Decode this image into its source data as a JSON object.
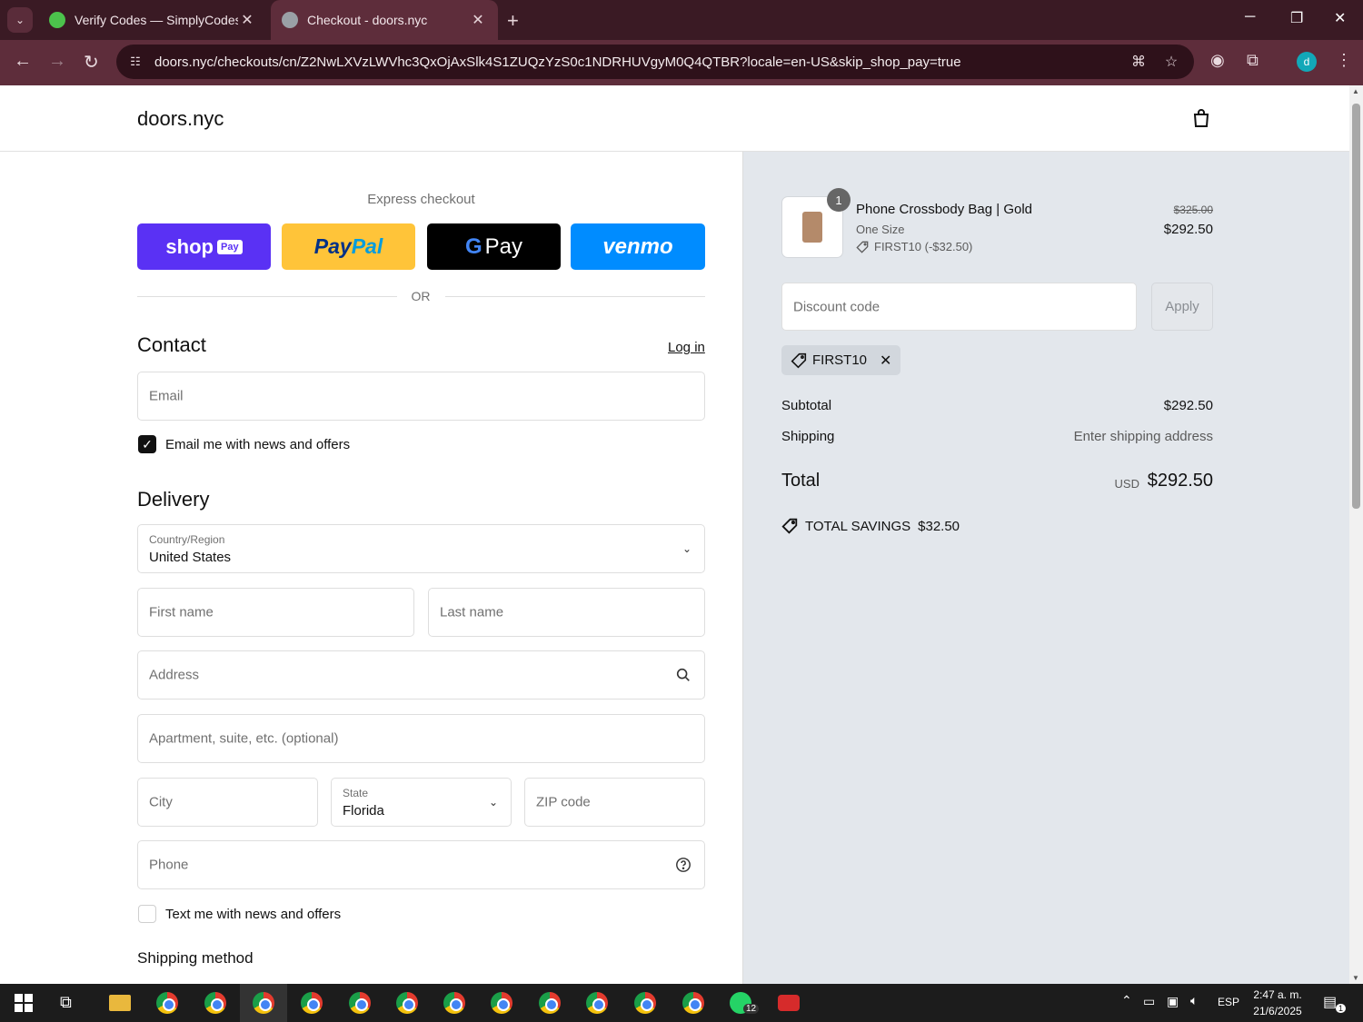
{
  "browser": {
    "tabs": [
      {
        "title": "Verify Codes — SimplyCodes",
        "favicon": "simplycodes-icon",
        "color": "#4cc24c"
      },
      {
        "title": "Checkout - doors.nyc",
        "favicon": "globe-icon",
        "color": "#9aa0a6",
        "active": true
      }
    ],
    "url": "doors.nyc/checkouts/cn/Z2NwLXVzLWVhc3QxOjAxSlk4S1ZUQzYzS0c1NDRHUVgyM0Q4QTBR?locale=en-US&skip_shop_pay=true",
    "profile_initial": "d"
  },
  "page": {
    "brand": "doors.nyc",
    "express_checkout": "Express checkout",
    "pay_buttons": {
      "shop": "shop",
      "shop_pay": "Pay",
      "paypal_1": "Pay",
      "paypal_2": "Pal",
      "gpay": "Pay",
      "gpay_g": "G",
      "venmo": "venmo"
    },
    "or": "OR",
    "contact": {
      "heading": "Contact",
      "login": "Log in",
      "email_placeholder": "Email",
      "news_label": "Email me with news and offers",
      "news_checked": true
    },
    "delivery": {
      "heading": "Delivery",
      "country_label": "Country/Region",
      "country_value": "United States",
      "first_name": "First name",
      "last_name": "Last name",
      "address": "Address",
      "apartment": "Apartment, suite, etc. (optional)",
      "city": "City",
      "state_label": "State",
      "state_value": "Florida",
      "zip": "ZIP code",
      "phone": "Phone",
      "sms_label": "Text me with news and offers",
      "sms_checked": false
    },
    "shipping_method": "Shipping method"
  },
  "summary": {
    "item": {
      "qty": "1",
      "name": "Phone Crossbody Bag | Gold",
      "variant": "One Size",
      "discount": "FIRST10 (-$32.50)",
      "old_price": "$325.00",
      "price": "$292.50"
    },
    "discount_placeholder": "Discount code",
    "apply": "Apply",
    "applied_code": "FIRST10",
    "subtotal_label": "Subtotal",
    "subtotal": "$292.50",
    "shipping_label": "Shipping",
    "shipping": "Enter shipping address",
    "total_label": "Total",
    "currency": "USD",
    "total": "$292.50",
    "savings_label": "TOTAL SAVINGS",
    "savings": "$32.50"
  },
  "taskbar": {
    "badge": "12",
    "lang": "ESP",
    "time": "2:47 a. m.",
    "date": "21/6/2025",
    "notifications": "1"
  }
}
